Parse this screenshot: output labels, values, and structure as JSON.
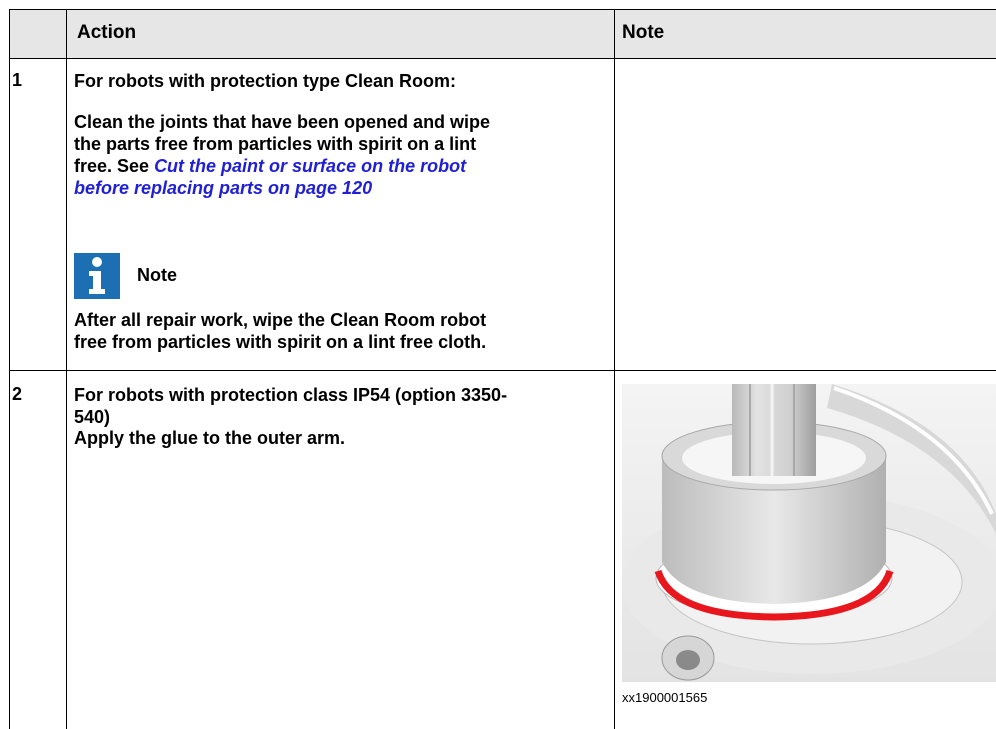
{
  "table": {
    "headers": {
      "step": "",
      "action": "Action",
      "note": "Note"
    },
    "rows": [
      {
        "step": "1",
        "action": {
          "line1": "For robots with protection type Clean Room:",
          "para_lines": [
            "Clean the joints that have been opened and wipe",
            "the parts free from particles with spirit on a lint",
            "free. See "
          ],
          "link_lines": [
            "Cut the paint or surface on the robot",
            "before replacing parts on page 120"
          ],
          "note_label": "Note",
          "note_lines": [
            "After all repair work, wipe the Clean Room robot",
            "free from particles with spirit on a lint free cloth."
          ]
        }
      },
      {
        "step": "2",
        "action": {
          "line1a": "For robots with protection class IP54 (option 3350-",
          "line1b": "540)",
          "line2": "Apply the glue to the outer arm."
        },
        "figure_caption": "xx1900001565"
      }
    ]
  },
  "colors": {
    "header_bg": "#e6e6e6",
    "link": "#1f1fd6",
    "note_icon": "#1d6fb3",
    "glue": "#e8161d"
  }
}
